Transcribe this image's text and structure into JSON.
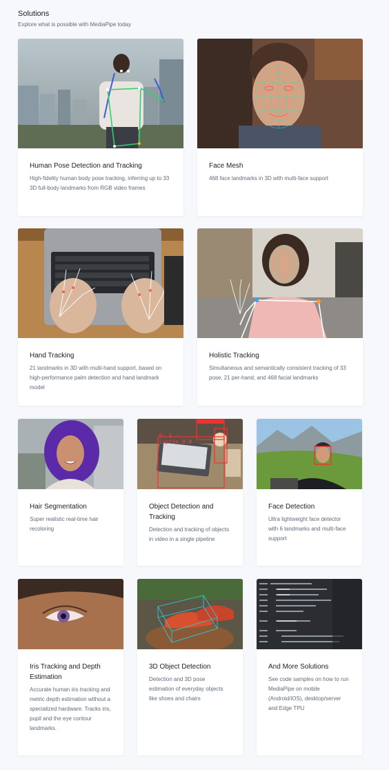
{
  "header": {
    "title": "Solutions",
    "subtitle": "Explore what is possible with MediaPipe today"
  },
  "cards": [
    {
      "title": "Human Pose Detection and Tracking",
      "desc": "High-fidelity human body pose tracking, inferring up to 33 3D full-body landmarks from RGB video frames",
      "image_icon": "pose-image"
    },
    {
      "title": "Face Mesh",
      "desc": "468 face landmarks in 3D with multi-face support",
      "image_icon": "face-mesh-image"
    },
    {
      "title": "Hand Tracking",
      "desc": "21 landmarks in 3D with multi-hand support, based on high-performance palm detection and hand landmark model",
      "image_icon": "hand-tracking-image"
    },
    {
      "title": "Holistic Tracking",
      "desc": "Simultaneous and semantically consistent tracking of 33 pose, 21 per-hand, and 468 facial landmarks",
      "image_icon": "holistic-image"
    },
    {
      "title": "Hair Segmentation",
      "desc": "Super realistic real-time hair recoloring",
      "image_icon": "hair-image"
    },
    {
      "title": "Object Detection and Tracking",
      "desc": "Detection and tracking of objects in video in a single pipeline",
      "image_icon": "object-detection-image",
      "overlay_labels": [
        "d: 1",
        "laptop,0.8"
      ]
    },
    {
      "title": "Face Detection",
      "desc": "Ultra lightweight face detector with 6 landmarks and multi-face support",
      "image_icon": "face-detection-image"
    },
    {
      "title": "Iris Tracking and Depth Estimation",
      "desc": "Accurate human iris tracking and metric depth estimation without a specialized hardware. Tracks iris, pupil and the eye contour landmarks.",
      "image_icon": "iris-image"
    },
    {
      "title": "3D Object Detection",
      "desc": "Detection and 3D pose estimation of everyday objects like shoes and chairs",
      "image_icon": "objectron-image"
    },
    {
      "title": "And More Solutions",
      "desc": "See code samples on how to run MediaPipe on mobile (Android/iOS), desktop/server and Edge TPU",
      "image_icon": "code-image"
    }
  ]
}
